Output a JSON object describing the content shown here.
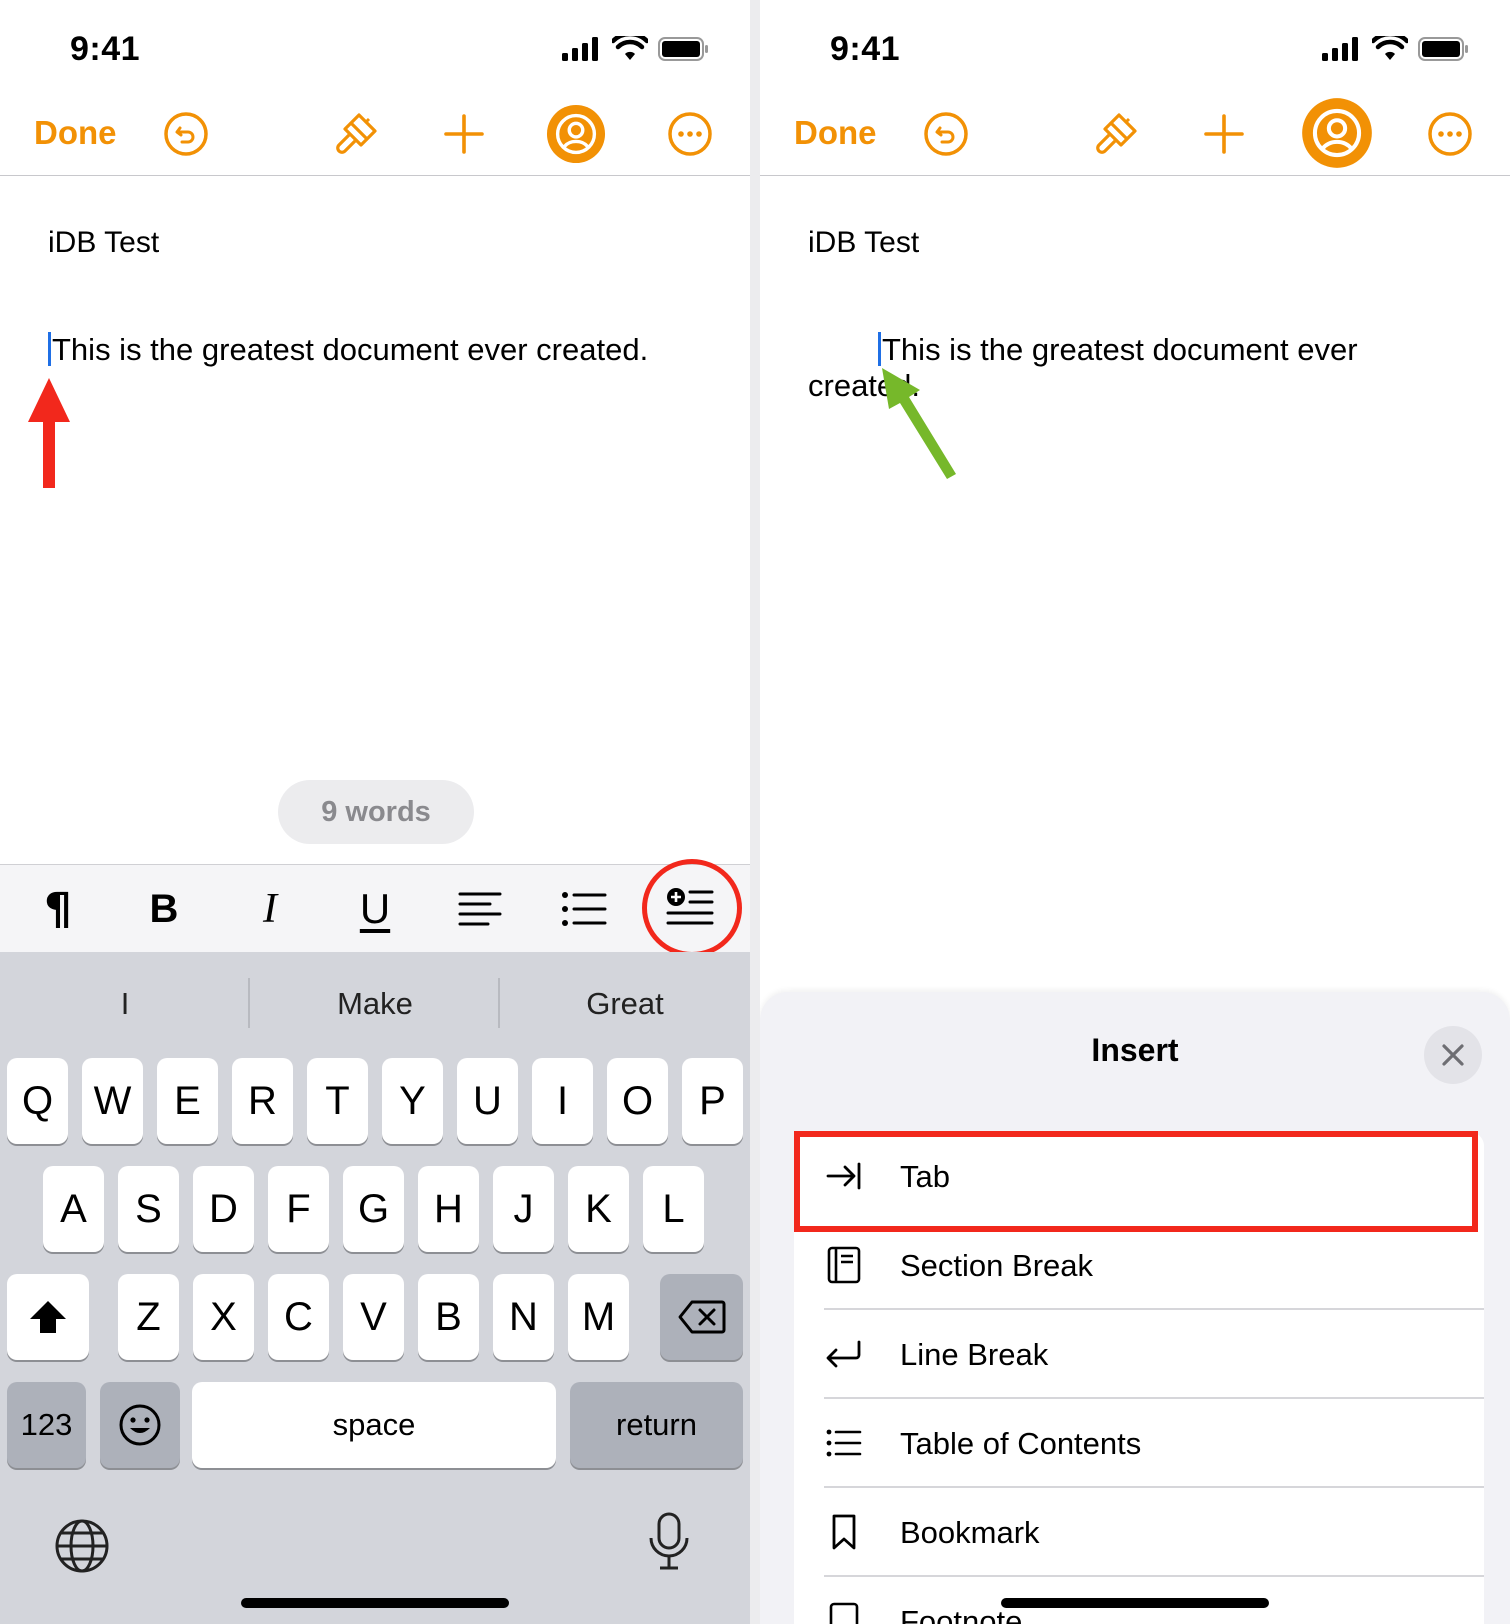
{
  "status": {
    "time": "9:41"
  },
  "toolbar": {
    "done_label": "Done"
  },
  "document": {
    "title": "iDB Test",
    "body": "This is the greatest document ever created."
  },
  "left_screen": {
    "word_count": "9 words",
    "format_bar": {
      "bold": "B",
      "italic": "I",
      "underline": "U"
    },
    "suggestions": [
      "I",
      "Make",
      "Great"
    ],
    "keyboard": {
      "row1": [
        "Q",
        "W",
        "E",
        "R",
        "T",
        "Y",
        "U",
        "I",
        "O",
        "P"
      ],
      "row2": [
        "A",
        "S",
        "D",
        "F",
        "G",
        "H",
        "J",
        "K",
        "L"
      ],
      "row3": [
        "Z",
        "X",
        "C",
        "V",
        "B",
        "N",
        "M"
      ],
      "numbers_key": "123",
      "space_key": "space",
      "return_key": "return"
    }
  },
  "right_screen": {
    "insert_sheet": {
      "title": "Insert",
      "items": [
        {
          "label": "Tab",
          "icon": "tab-arrow-icon"
        },
        {
          "label": "Section Break",
          "icon": "section-break-icon"
        },
        {
          "label": "Line Break",
          "icon": "line-break-icon"
        },
        {
          "label": "Table of Contents",
          "icon": "list-icon"
        },
        {
          "label": "Bookmark",
          "icon": "bookmark-icon"
        },
        {
          "label": "Footnote",
          "icon": "footnote-icon"
        }
      ]
    }
  },
  "colors": {
    "accent_orange": "#f29105",
    "annotation_red": "#f2281c",
    "annotation_green": "#76b82a",
    "caret_blue": "#1f6fe5"
  }
}
